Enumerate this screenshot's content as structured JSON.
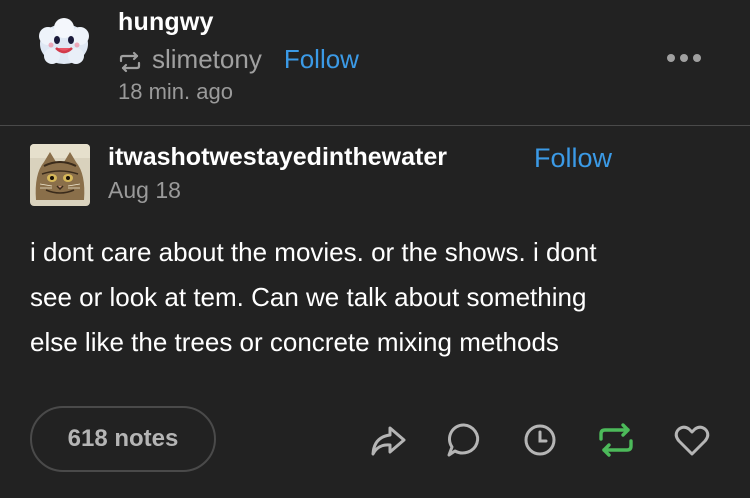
{
  "reblogger": {
    "username": "hungwy",
    "via": "slimetony",
    "follow_label": "Follow",
    "time": "18 min. ago"
  },
  "post": {
    "username": "itwashotwestayedinthewater",
    "follow_label": "Follow",
    "date": "Aug 18",
    "lines": [
      "i dont care about the movies. or the shows. i dont",
      "see or look at tem. Can we talk about something",
      "else like the trees or concrete mixing methods"
    ]
  },
  "footer": {
    "notes_label": "618 notes"
  },
  "colors": {
    "background": "#222222",
    "link_blue": "#3b9ae6",
    "reblog_green": "#4cba5a",
    "muted": "#9a9a9a"
  },
  "icons": [
    "reblog-small-icon",
    "more-icon",
    "share-icon",
    "reply-icon",
    "schedule-icon",
    "reblog-icon",
    "like-icon"
  ]
}
